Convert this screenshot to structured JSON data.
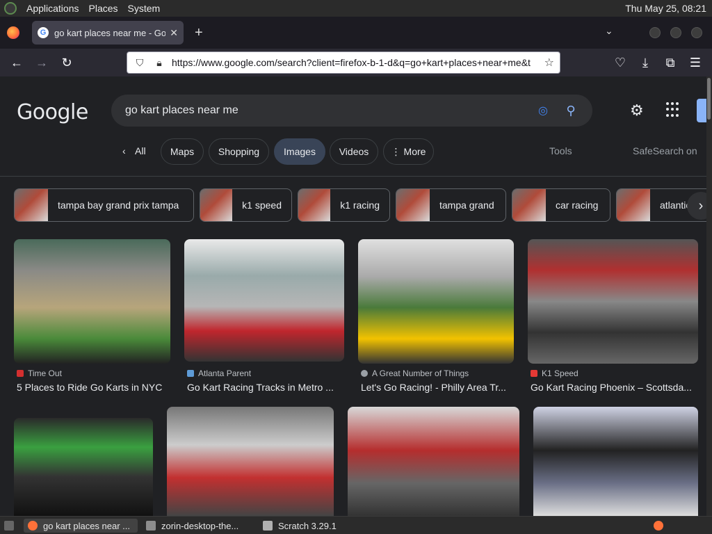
{
  "os": {
    "menu": [
      "Applications",
      "Places",
      "System"
    ],
    "clock": "Thu May 25, 08:21"
  },
  "browser": {
    "tab_title": "go kart places near me - Google",
    "tab_favicon": "G",
    "new_tab_label": "+",
    "url": "https://www.google.com/search?client=firefox-b-1-d&q=go+kart+places+near+me&t",
    "back_label": "←",
    "forward_label": "→",
    "reload_label": "↻"
  },
  "google": {
    "logo": "Google",
    "query": "go kart places near me",
    "filters": [
      {
        "label": "All"
      },
      {
        "label": "Maps"
      },
      {
        "label": "Shopping"
      },
      {
        "label": "Images",
        "active": true
      },
      {
        "label": "Videos"
      },
      {
        "label": "More"
      }
    ],
    "tools_label": "Tools",
    "safesearch_label": "SafeSearch on",
    "related": [
      "tampa bay grand prix tampa",
      "k1 speed",
      "k1 racing",
      "tampa grand",
      "car racing",
      "atlantic"
    ],
    "results_row1": [
      {
        "source": "Time Out",
        "title": "5 Places to Ride Go Karts in NYC"
      },
      {
        "source": "Atlanta Parent",
        "title": "Go Kart Racing Tracks in Metro ..."
      },
      {
        "source": "A Great Number of Things",
        "title": "Let's Go Racing! - Philly Area Tr..."
      },
      {
        "source": "K1 Speed",
        "title": "Go Kart Racing Phoenix – Scottsda..."
      }
    ]
  },
  "taskbar": {
    "items": [
      "go kart places near ...",
      "zorin-desktop-the...",
      "Scratch 3.29.1"
    ]
  },
  "colors": {
    "page_bg": "#202124",
    "accent_blue": "#8ab4f8",
    "chip_active": "#394457"
  }
}
